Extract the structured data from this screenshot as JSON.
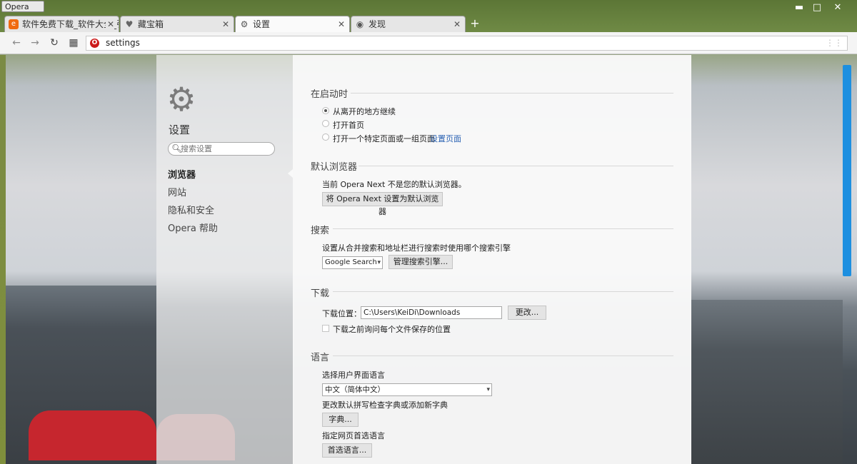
{
  "browser": {
    "menu_label": "Opera",
    "window_controls": {
      "minimize": "▬",
      "maximize": "□",
      "close": "✕"
    },
    "tabs": [
      {
        "label": "软件免费下载_软件大全_引",
        "icon": "site-favicon",
        "active": false
      },
      {
        "label": "藏宝箱",
        "icon": "heart-icon",
        "active": false
      },
      {
        "label": "设置",
        "icon": "gear-icon",
        "active": true
      },
      {
        "label": "发现",
        "icon": "eye-icon",
        "active": false
      }
    ],
    "tab_close": "✕",
    "new_tab": "+",
    "address": "settings",
    "nav_icons": {
      "back": "←",
      "forward": "→",
      "reload": "↻",
      "speed_dial": "▦"
    }
  },
  "sidebar": {
    "title": "设置",
    "search_placeholder": "搜索设置",
    "items": [
      {
        "label": "浏览器",
        "selected": true
      },
      {
        "label": "网站",
        "selected": false
      },
      {
        "label": "隐私和安全",
        "selected": false
      },
      {
        "label": "Opera 帮助",
        "selected": false
      }
    ]
  },
  "startup": {
    "heading": "在启动时",
    "options": [
      {
        "label": "从离开的地方继续",
        "checked": true
      },
      {
        "label": "打开首页",
        "checked": false
      },
      {
        "label": "打开一个特定页面或一组页面",
        "checked": false
      }
    ],
    "set_pages_link": "设置页面"
  },
  "default_browser": {
    "heading": "默认浏览器",
    "status": "当前 Opera Next 不是您的默认浏览器。",
    "button": "将 Opera Next 设置为默认浏览器"
  },
  "search": {
    "heading": "搜索",
    "description": "设置从合并搜索和地址栏进行搜索时使用哪个搜索引擎",
    "engine": "Google Search",
    "manage_button": "管理搜索引擎..."
  },
  "downloads": {
    "heading": "下载",
    "location_label": "下载位置：",
    "path": "C:\\Users\\KeiDi\\Downloads",
    "change_button": "更改...",
    "ask_label": "下载之前询问每个文件保存的位置",
    "ask_checked": false
  },
  "language": {
    "heading": "语言",
    "ui_language_label": "选择用户界面语言",
    "ui_language": "中文（简体中文）",
    "spellcheck_label": "更改默认拼写检查字典或添加新字典",
    "dictionary_button": "字典...",
    "preferred_label": "指定网页首选语言",
    "preferred_button": "首选语言..."
  }
}
